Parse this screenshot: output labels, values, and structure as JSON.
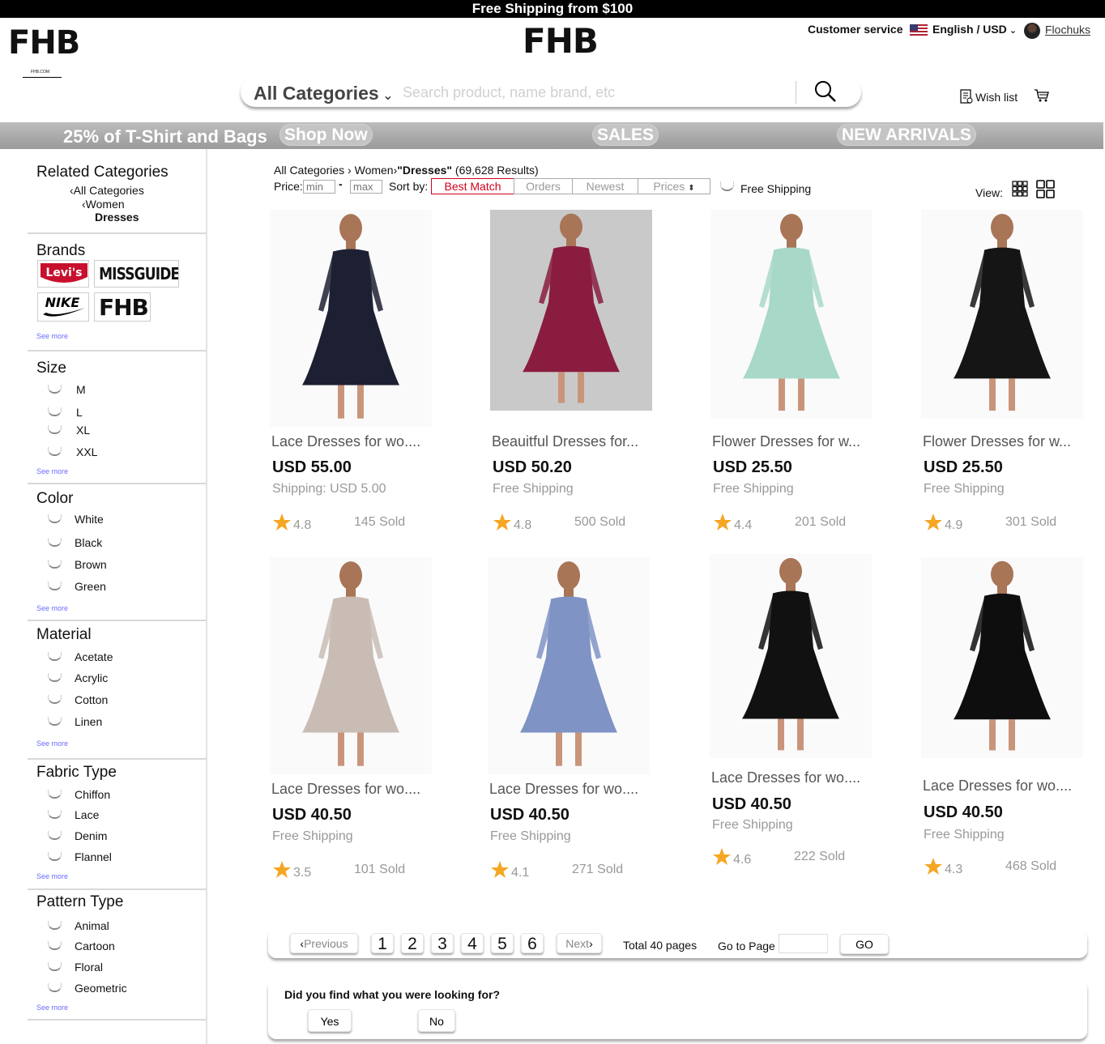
{
  "banner": {
    "text": "Free Shipping from $100"
  },
  "brand": {
    "logo": "FHB",
    "site": "FHB.COM"
  },
  "header": {
    "customer_service": "Customer service",
    "language": "English / USD",
    "username": "Flochuks",
    "category_select": "All Categories",
    "search_placeholder": "Search product, name brand, etc",
    "wish_list": "Wish list"
  },
  "promo": {
    "text": "25% of T-Shirt and Bags",
    "shop_now": "Shop Now",
    "sales": "SALES",
    "new_arrivals": "NEW ARRIVALS"
  },
  "sidebar": {
    "related_title": "Related Categories",
    "related": [
      "All Categories",
      "Women",
      "Dresses"
    ],
    "brands_title": "Brands",
    "brands": [
      "Levi's",
      "MISSGUIDED",
      "NIKE",
      "FHB"
    ],
    "see_more": "See more",
    "sections": [
      {
        "title": "Size",
        "options": [
          "M",
          "L",
          "XL",
          "XXL"
        ]
      },
      {
        "title": "Color",
        "options": [
          "White",
          "Black",
          "Brown",
          "Green"
        ]
      },
      {
        "title": "Material",
        "options": [
          "Acetate",
          "Acrylic",
          "Cotton",
          "Linen"
        ]
      },
      {
        "title": "Fabric Type",
        "options": [
          "Chiffon",
          "Lace",
          "Denim",
          "Flannel"
        ]
      },
      {
        "title": "Pattern Type",
        "options": [
          "Animal",
          "Cartoon",
          "Floral",
          "Geometric"
        ]
      }
    ]
  },
  "results": {
    "breadcrumb_1": "All Categories",
    "breadcrumb_2": "Women",
    "query": "\"Dresses\"",
    "count": "(69,628 Results)",
    "price_label": "Price:",
    "min_placeholder": "min",
    "max_placeholder": "max",
    "sort_label": "Sort by:",
    "sort_options": [
      "Best Match",
      "Orders",
      "Newest",
      "Prices"
    ],
    "free_shipping": "Free Shipping",
    "view_label": "View:"
  },
  "products": [
    {
      "title": "Lace Dresses for wo....",
      "price": "USD 55.00",
      "shipping": "Shipping: USD 5.00",
      "rating": "4.8",
      "sold": "145 Sold",
      "dress_color": "#1d2033"
    },
    {
      "title": "Beauitful Dresses for...",
      "price": "USD 50.20",
      "shipping": "Free Shipping",
      "rating": "4.8",
      "sold": "500 Sold",
      "dress_color": "#8a1d3f"
    },
    {
      "title": "Flower Dresses for w...",
      "price": "USD 25.50",
      "shipping": "Free Shipping",
      "rating": "4.4",
      "sold": "201 Sold",
      "dress_color": "#a8d8c8"
    },
    {
      "title": "Flower Dresses for w...",
      "price": "USD 25.50",
      "shipping": "Free Shipping",
      "rating": "4.9",
      "sold": "301 Sold",
      "dress_color": "#151515"
    },
    {
      "title": "Lace Dresses for wo....",
      "price": "USD 40.50",
      "shipping": "Free Shipping",
      "rating": "3.5",
      "sold": "101 Sold",
      "dress_color": "#c9bcb4"
    },
    {
      "title": "Lace Dresses for wo....",
      "price": "USD 40.50",
      "shipping": "Free Shipping",
      "rating": "4.1",
      "sold": "271 Sold",
      "dress_color": "#7f93c4"
    },
    {
      "title": "Lace Dresses for wo....",
      "price": "USD 40.50",
      "shipping": "Free Shipping",
      "rating": "4.6",
      "sold": "222 Sold",
      "dress_color": "#111111"
    },
    {
      "title": "Lace Dresses for wo....",
      "price": "USD 40.50",
      "shipping": "Free Shipping",
      "rating": "4.3",
      "sold": "468 Sold",
      "dress_color": "#0e0e0e"
    }
  ],
  "pagination": {
    "previous": "Previous",
    "pages": [
      "1",
      "2",
      "3",
      "4",
      "5",
      "6"
    ],
    "next": "Next",
    "total": "Total 40 pages",
    "goto_label": "Go to Page",
    "go": "GO"
  },
  "feedback": {
    "question": "Did you find what you were looking for?",
    "yes": "Yes",
    "no": "No"
  },
  "colors": {
    "accent_red": "#d0021b",
    "star": "#f5a623",
    "promo_gray": "#aaaaaa"
  }
}
